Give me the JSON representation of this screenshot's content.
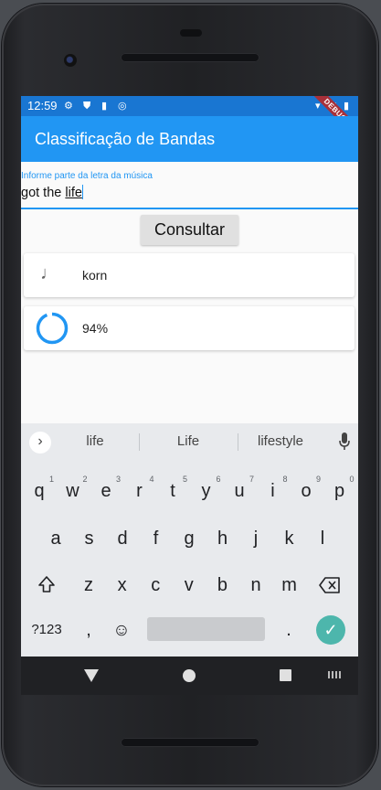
{
  "status": {
    "time": "12:59",
    "debug_label": "DEBUG"
  },
  "app": {
    "title": "Classificação de Bandas"
  },
  "input": {
    "label": "Informe parte da letra da música",
    "value_prefix": "got the ",
    "value_underlined": "life"
  },
  "button": {
    "label": "Consultar"
  },
  "results": [
    {
      "icon": "music-note-icon",
      "text": "korn"
    },
    {
      "icon": "progress-spinner-icon",
      "text": "94%",
      "progress": 0.94
    }
  ],
  "keyboard": {
    "suggestions": [
      "life",
      "Life",
      "lifestyle"
    ],
    "row1": [
      "q",
      "w",
      "e",
      "r",
      "t",
      "y",
      "u",
      "i",
      "o",
      "p"
    ],
    "row1_hints": [
      "1",
      "2",
      "3",
      "4",
      "5",
      "6",
      "7",
      "8",
      "9",
      "0"
    ],
    "row2": [
      "a",
      "s",
      "d",
      "f",
      "g",
      "h",
      "j",
      "k",
      "l"
    ],
    "row3": [
      "z",
      "x",
      "c",
      "v",
      "b",
      "n",
      "m"
    ],
    "symbols_label": "?123",
    "comma": ",",
    "period": "."
  },
  "colors": {
    "appbar": "#2196f3",
    "statusbar": "#1976d2",
    "accent": "#2196f3",
    "enter": "#4db6ac"
  }
}
